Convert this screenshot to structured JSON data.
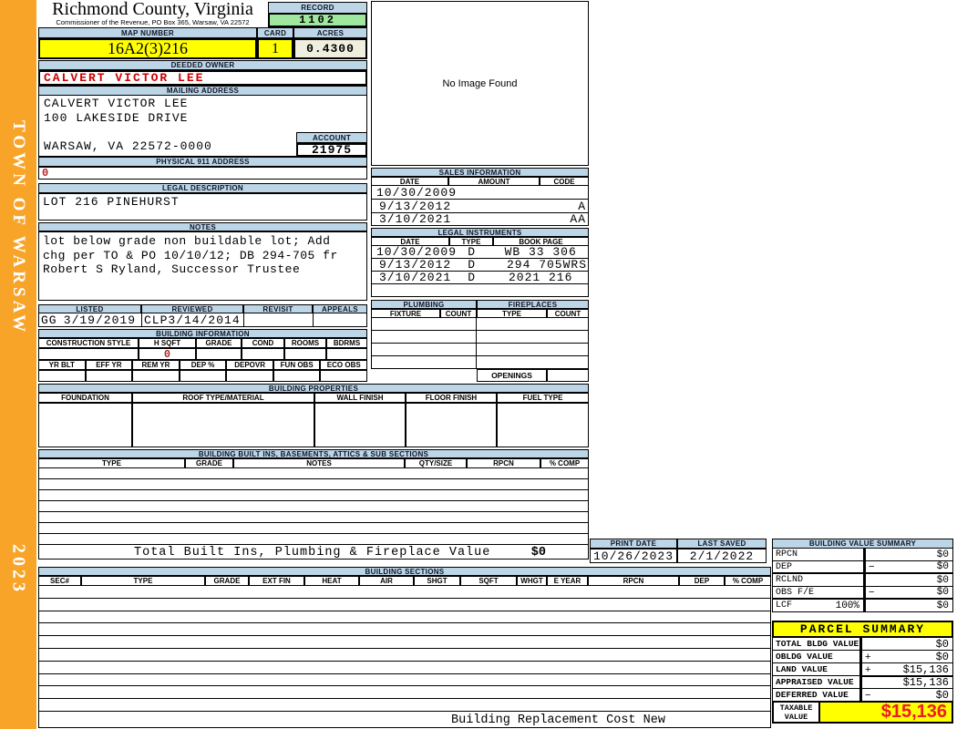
{
  "colors": {
    "header_blue": "#BCD6E8",
    "highlight_yellow": "#FFFF00",
    "record_green": "#9FE79F",
    "acres_cream": "#F0EFDF",
    "sidebar_orange": "#F7A428",
    "owner_red": "#CC0000",
    "taxable_red": "#EC1C24"
  },
  "sidebar": {
    "town": "TOWN OF WARSAW",
    "year": "2023"
  },
  "header": {
    "county": "Richmond County, Virginia",
    "commissioner": "Commissioner of the Revenue, PO Box 365, Warsaw, VA 22572",
    "record_label": "RECORD",
    "record_value": "1102",
    "map_number_label": "MAP NUMBER",
    "map_number_value": "16A2(3)216",
    "card_label": "CARD",
    "card_value": "1",
    "acres_label": "ACRES",
    "acres_value": "0.4300"
  },
  "owner": {
    "deeded_owner_label": "DEEDED OWNER",
    "deeded_owner": "CALVERT VICTOR LEE",
    "mailing_address_label": "MAILING ADDRESS",
    "mailing_lines": [
      "CALVERT VICTOR LEE",
      "100 LAKESIDE DRIVE",
      "",
      "WARSAW, VA 22572-0000"
    ],
    "account_label": "ACCOUNT",
    "account_value": "21975",
    "physical_911_label": "PHYSICAL 911 ADDRESS",
    "physical_911_value": "0",
    "legal_description_label": "LEGAL DESCRIPTION",
    "legal_description": "LOT 216 PINEHURST",
    "notes_label": "NOTES",
    "notes_lines": [
      "lot below grade non buildable lot; Add",
      "chg per TO & PO 10/10/12; DB 294-705 fr",
      "Robert S Ryland, Successor Trustee"
    ]
  },
  "image_box": {
    "text": "No Image Found"
  },
  "sales": {
    "title": "SALES INFORMATION",
    "columns": [
      "DATE",
      "AMOUNT",
      "CODE"
    ],
    "rows": [
      [
        "10/30/2009",
        "",
        ""
      ],
      [
        "9/13/2012",
        "",
        "A"
      ],
      [
        "3/10/2021",
        "",
        "AA"
      ]
    ]
  },
  "legal_instruments": {
    "title": "LEGAL INSTRUMENTS",
    "columns": [
      "DATE",
      "TYPE",
      "BOOK PAGE"
    ],
    "rows": [
      [
        "10/30/2009",
        "D",
        "WB 33 306"
      ],
      [
        "9/13/2012",
        "D",
        "294 705WRS"
      ],
      [
        "3/10/2021",
        "D",
        "2021 216"
      ],
      [
        "",
        "",
        ""
      ]
    ]
  },
  "plumbing_fireplaces": {
    "plumbing_title": "PLUMBING",
    "fixture_label": "FIXTURE",
    "count_label": "COUNT",
    "fireplaces_title": "FIREPLACES",
    "type_label": "TYPE",
    "count2_label": "COUNT",
    "openings_label": "OPENINGS"
  },
  "review": {
    "listed_label": "LISTED",
    "listed_by": "GG",
    "listed_date": "3/19/2019",
    "reviewed_label": "REVIEWED",
    "reviewed_by": "CLP",
    "reviewed_date": "3/14/2014",
    "revisit_label": "REVISIT",
    "appeals_label": "APPEALS"
  },
  "building_information": {
    "title": "BUILDING INFORMATION",
    "columns_row1": [
      "CONSTRUCTION STYLE",
      "H SQFT",
      "GRADE",
      "COND",
      "ROOMS",
      "BDRMS"
    ],
    "h_sqft_value": "0",
    "columns_row2": [
      "YR BLT",
      "EFF YR",
      "REM YR",
      "DEP %",
      "DEPOVR",
      "FUN OBS",
      "ECO OBS"
    ]
  },
  "building_properties": {
    "title": "BUILDING PROPERTIES",
    "columns": [
      "FOUNDATION",
      "ROOF TYPE/MATERIAL",
      "WALL FINISH",
      "FLOOR FINISH",
      "FUEL TYPE"
    ]
  },
  "built_ins": {
    "title": "BUILDING BUILT INS, BASEMENTS, ATTICS & SUB SECTIONS",
    "columns": [
      "TYPE",
      "GRADE",
      "NOTES",
      "QTY/SIZE",
      "RPCN",
      "% COMP"
    ],
    "total_label": "Total Built Ins, Plumbing & Fireplace Value",
    "total_value": "$0"
  },
  "print_info": {
    "print_date_label": "PRINT DATE",
    "print_date": "10/26/2023",
    "last_saved_label": "LAST SAVED",
    "last_saved": "2/1/2022"
  },
  "building_value_summary": {
    "title": "BUILDING VALUE SUMMARY",
    "rows": [
      {
        "label": "RPCN",
        "extra": "",
        "op": "",
        "value": "$0"
      },
      {
        "label": "DEP",
        "extra": "",
        "op": "−",
        "value": "$0"
      },
      {
        "label": "RCLND",
        "extra": "",
        "op": "",
        "value": "$0"
      },
      {
        "label": "OBS F/E",
        "extra": "",
        "op": "−",
        "value": "$0"
      },
      {
        "label": "LCF",
        "extra": "100%",
        "op": "",
        "value": "$0"
      }
    ]
  },
  "building_sections": {
    "title": "BUILDING SECTIONS",
    "columns": [
      "SEC#",
      "TYPE",
      "GRADE",
      "EXT FIN",
      "HEAT",
      "AIR",
      "SHGT",
      "SQFT",
      "WHGT",
      "E YEAR",
      "RPCN",
      "DEP",
      "% COMP"
    ],
    "footer": "Building Replacement Cost New"
  },
  "parcel_summary": {
    "title": "PARCEL SUMMARY",
    "rows": [
      {
        "label": "TOTAL BLDG VALUE",
        "op": "",
        "value": "$0"
      },
      {
        "label": "OBLDG VALUE",
        "op": "+",
        "value": "$0"
      },
      {
        "label": "LAND VALUE",
        "op": "+",
        "value": "$15,136"
      },
      {
        "label": "APPRAISED VALUE",
        "op": "",
        "value": "$15,136"
      },
      {
        "label": "DEFERRED VALUE",
        "op": "−",
        "value": "$0"
      }
    ],
    "taxable_label_line1": "TAXABLE",
    "taxable_label_line2": "VALUE",
    "taxable_value": "$15,136"
  }
}
